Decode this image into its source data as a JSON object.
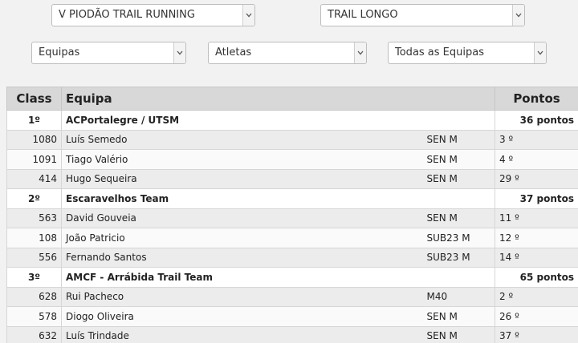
{
  "filters": {
    "event": "V PIODÃO TRAIL RUNNING",
    "race": "TRAIL LONGO",
    "view": "Equipas",
    "type": "Atletas",
    "team": "Todas as Equipas"
  },
  "table": {
    "headers": {
      "class": "Class",
      "team": "Equipa",
      "points": "Pontos"
    },
    "teams": [
      {
        "rank": "1º",
        "name": "ACPortalegre / UTSM",
        "points": "36 pontos",
        "athletes": [
          {
            "bib": "1080",
            "name": "Luís Semedo",
            "category": "SEN M",
            "pos": "3 º"
          },
          {
            "bib": "1091",
            "name": "Tiago Valério",
            "category": "SEN M",
            "pos": "4 º"
          },
          {
            "bib": "414",
            "name": "Hugo Sequeira",
            "category": "SEN M",
            "pos": "29 º"
          }
        ]
      },
      {
        "rank": "2º",
        "name": "Escaravelhos Team",
        "points": "37 pontos",
        "athletes": [
          {
            "bib": "563",
            "name": "David Gouveia",
            "category": "SEN M",
            "pos": "11 º"
          },
          {
            "bib": "108",
            "name": "João Patricio",
            "category": "SUB23 M",
            "pos": "12 º"
          },
          {
            "bib": "556",
            "name": "Fernando Santos",
            "category": "SUB23 M",
            "pos": "14 º"
          }
        ]
      },
      {
        "rank": "3º",
        "name": "AMCF - Arrábida Trail Team",
        "points": "65 pontos",
        "athletes": [
          {
            "bib": "628",
            "name": "Rui Pacheco",
            "category": "M40",
            "pos": "2 º"
          },
          {
            "bib": "578",
            "name": "Diogo Oliveira",
            "category": "SEN M",
            "pos": "26 º"
          },
          {
            "bib": "632",
            "name": "Luís Trindade",
            "category": "SEN M",
            "pos": "37 º"
          }
        ]
      }
    ]
  }
}
